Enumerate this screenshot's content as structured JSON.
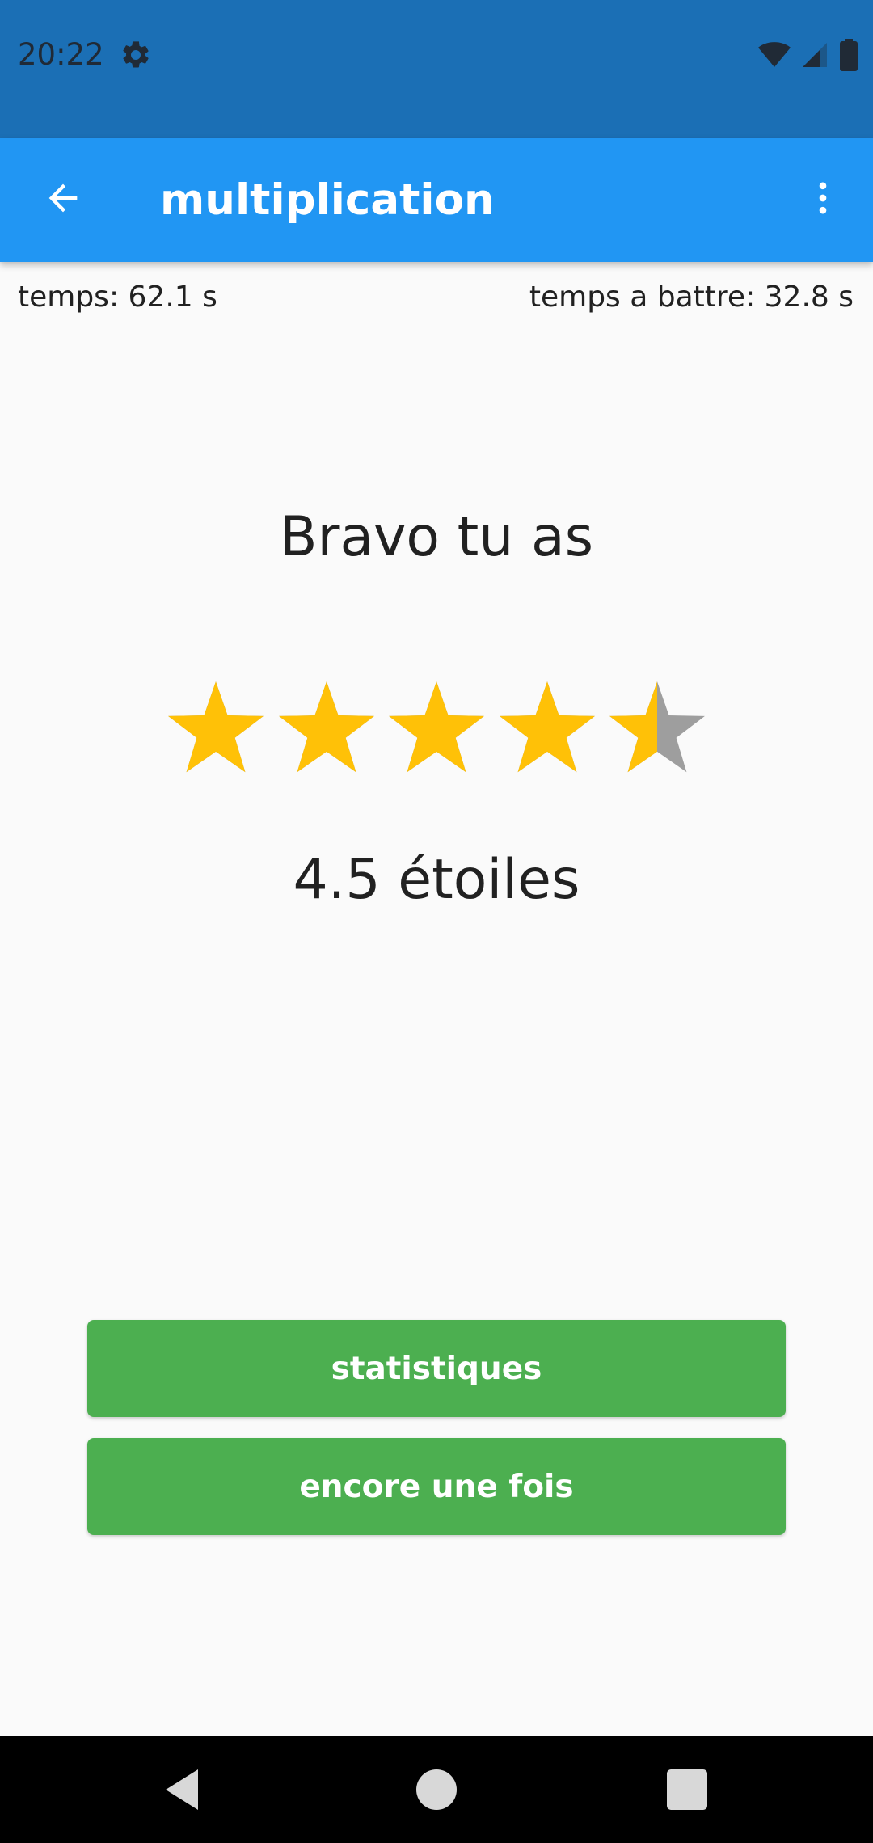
{
  "status_bar": {
    "time": "20:22",
    "icons": [
      "gear-icon",
      "wifi-icon",
      "signal-icon",
      "battery-icon"
    ]
  },
  "app_bar": {
    "title": "multiplication",
    "back_icon": "arrow-left-icon",
    "menu_icon": "more-vertical-icon"
  },
  "timing": {
    "elapsed": "temps: 62.1 s",
    "to_beat": "temps a battre: 32.8 s"
  },
  "result": {
    "heading": "Bravo tu as",
    "rating": 4.5,
    "max_rating": 5,
    "rating_label": "4.5 étoiles"
  },
  "buttons": {
    "stats": "statistiques",
    "again": "encore une fois"
  },
  "colors": {
    "status_bar": "#1b6fb5",
    "app_bar": "#2196f3",
    "star_filled": "#ffc107",
    "star_empty": "#9e9e9e",
    "button": "#4caf50"
  }
}
